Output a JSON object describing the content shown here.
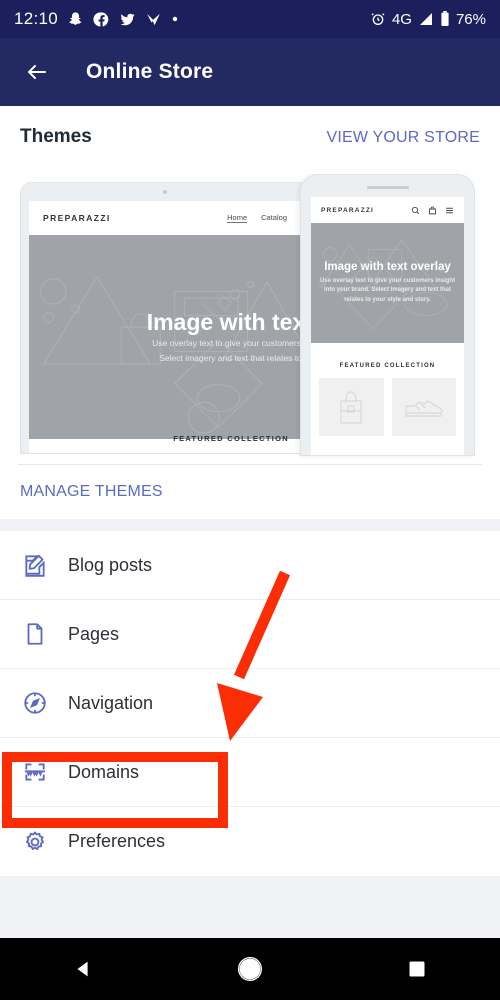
{
  "statusbar": {
    "time": "12:10",
    "icons": [
      "snapchat-icon",
      "facebook-icon",
      "twitter-icon",
      "gmail-icon",
      "dot-icon"
    ],
    "alarm_icon": "alarm-icon",
    "network": "4G",
    "signal_icon": "signal-icon",
    "battery_icon": "battery-icon",
    "battery": "76%"
  },
  "appbar": {
    "back_icon": "arrow-back-icon",
    "title": "Online Store"
  },
  "themes": {
    "title": "Themes",
    "view_store": "VIEW YOUR STORE",
    "manage_themes": "MANAGE THEMES",
    "tablet_preview": {
      "brand": "PREPARAZZI",
      "nav": [
        "Home",
        "Catalog"
      ],
      "hero_title": "Image with text o",
      "hero_sub_line1": "Use overlay text to give your customers insight",
      "hero_sub_line2": "Select imagery and text that relates to your",
      "featured": "FEATURED COLLECTION"
    },
    "phone_preview": {
      "brand": "PREPARAZZI",
      "icons": [
        "search-icon",
        "shopping-bag-icon",
        "hamburger-menu-icon"
      ],
      "hero_title": "Image with text overlay",
      "hero_sub": "Use overlay text to give your customers insight into your brand. Select imagery and text that relates to your style and story.",
      "featured": "FEATURED COLLECTION",
      "tiles": [
        "backpack-icon",
        "sneaker-icon"
      ]
    }
  },
  "menu": {
    "items": [
      {
        "label": "Blog posts",
        "icon": "compose-edit-icon"
      },
      {
        "label": "Pages",
        "icon": "document-page-icon"
      },
      {
        "label": "Navigation",
        "icon": "compass-icon"
      },
      {
        "label": "Domains",
        "icon": "www-domain-icon"
      },
      {
        "label": "Preferences",
        "icon": "gear-icon"
      }
    ]
  },
  "navbar": {
    "back": "back-triangle-icon",
    "home": "home-circle-icon",
    "recents": "recents-square-icon"
  },
  "annotations": {
    "highlight_target": "Domains",
    "arrow_color": "#fa2d05",
    "box_color": "#fa2d05"
  },
  "colors": {
    "status_bar": "#1b1f5c",
    "app_bar": "#232a63",
    "accent": "#5c6ac4",
    "page_bg": "#f1f2f5",
    "annotation": "#fa2d05"
  }
}
